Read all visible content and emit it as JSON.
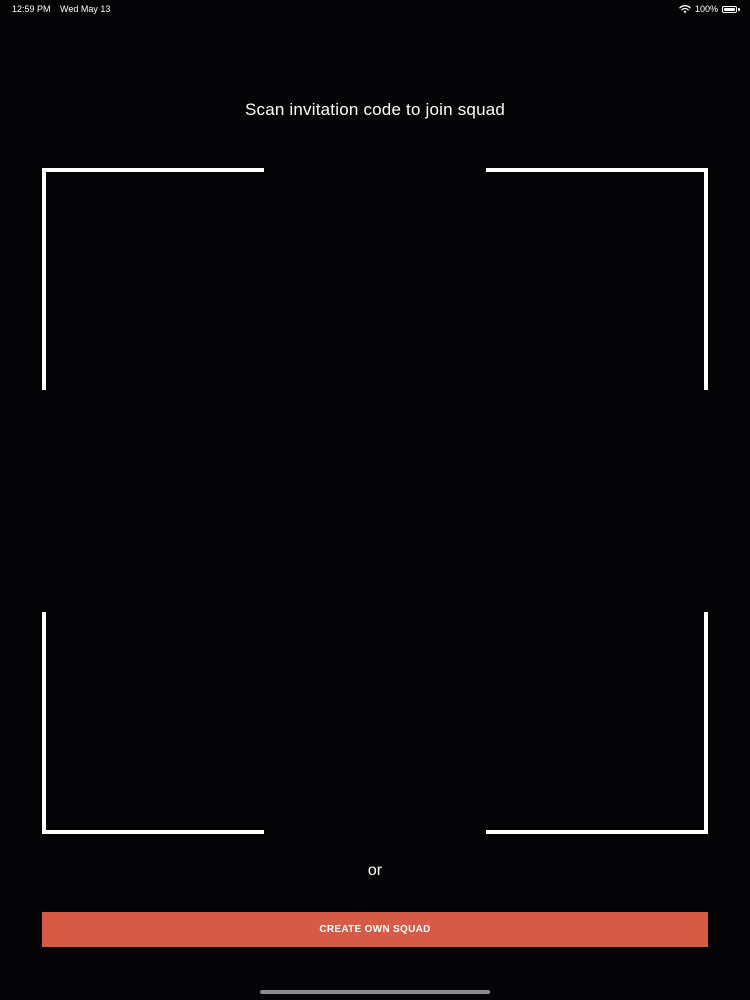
{
  "status_bar": {
    "time": "12:59 PM",
    "date": "Wed May 13",
    "battery": "100%",
    "wifi_icon": "wifi-icon",
    "battery_icon": "battery-icon"
  },
  "scanner": {
    "title": "Scan invitation code to join squad",
    "frame_color": "#ffffff"
  },
  "separator": {
    "text": "or"
  },
  "actions": {
    "create_squad_label": "CREATE OWN SQUAD",
    "button_color": "#d65a45"
  },
  "colors": {
    "background": "#040306",
    "text": "#ffffff"
  }
}
